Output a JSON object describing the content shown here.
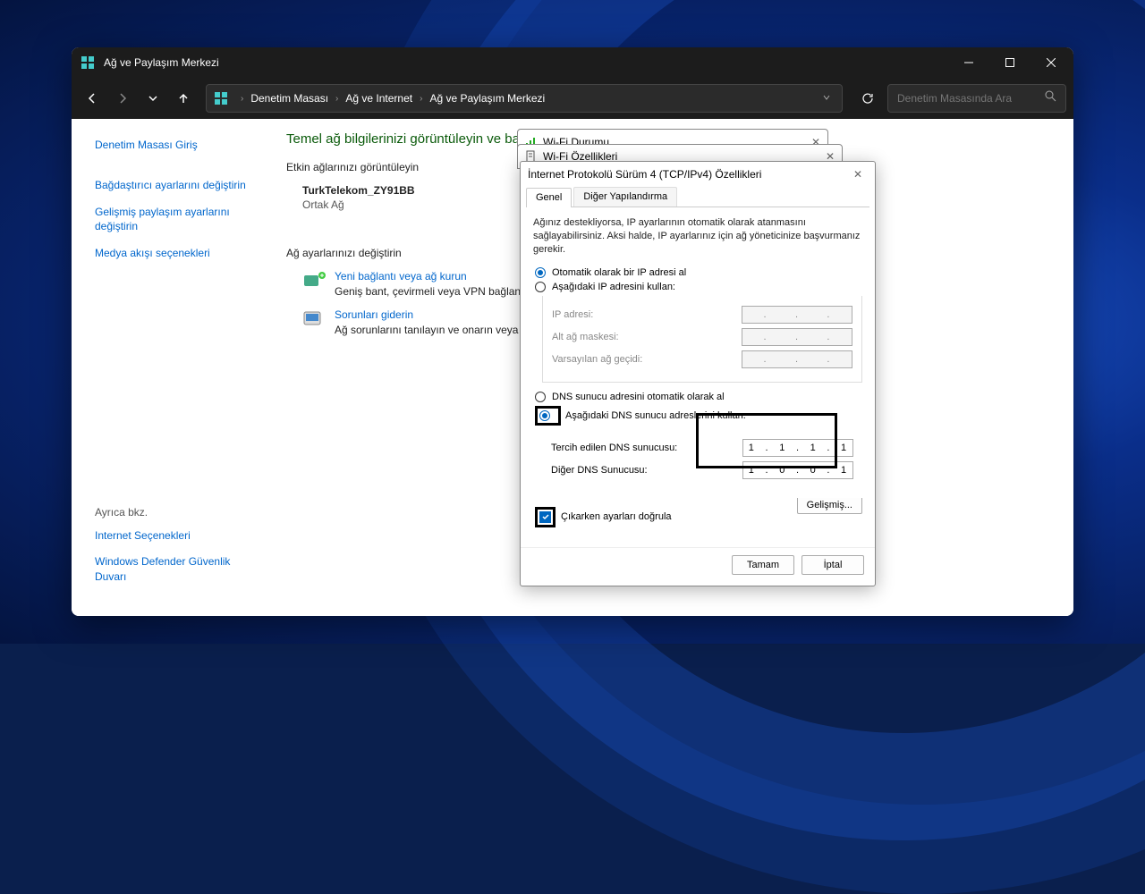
{
  "window": {
    "title": "Ağ ve Paylaşım Merkezi"
  },
  "breadcrumb": {
    "items": [
      "Denetim Masası",
      "Ağ ve Internet",
      "Ağ ve Paylaşım Merkezi"
    ]
  },
  "search": {
    "placeholder": "Denetim Masasında Ara"
  },
  "sidebar": {
    "home": "Denetim Masası Giriş",
    "adapter": "Bağdaştırıcı ayarlarını değiştirin",
    "sharing": "Gelişmiş paylaşım ayarlarını değiştirin",
    "media": "Medya akışı seçenekleri",
    "see_also": "Ayrıca bkz.",
    "internet_opts": "Internet Seçenekleri",
    "defender": "Windows Defender Güvenlik Duvarı"
  },
  "main": {
    "heading": "Temel ağ bilgilerinizi görüntüleyin ve ba",
    "active_label": "Etkin ağlarınızı görüntüleyin",
    "net_name": "TurkTelekom_ZY91BB",
    "net_type": "Ortak Ağ",
    "change_label": "Ağ ayarlarınızı değiştirin",
    "new_conn": "Yeni bağlantı veya ağ kurun",
    "new_conn_desc": "Geniş bant, çevirmeli veya VPN bağlantıs",
    "troubleshoot": "Sorunları giderin",
    "troubleshoot_desc": "Ağ sorunlarını tanılayın ve onarın veya so"
  },
  "wifi_status": {
    "title": "Wi-Fi Durumu"
  },
  "wifi_props": {
    "title": "Wi-Fi Özellikleri"
  },
  "ipv4": {
    "title": "İnternet Protokolü Sürüm 4 (TCP/IPv4) Özellikleri",
    "tabs": {
      "general": "Genel",
      "alt": "Diğer Yapılandırma"
    },
    "help": "Ağınız destekliyorsa, IP ayarlarının otomatik olarak atanmasını sağlayabilirsiniz. Aksi halde, IP ayarlarınız için ağ yöneticinize başvurmanız gerekir.",
    "ip_auto": "Otomatik olarak bir IP adresi al",
    "ip_manual": "Aşağıdaki IP adresini kullan:",
    "ip_addr": "IP adresi:",
    "subnet": "Alt ağ maskesi:",
    "gateway": "Varsayılan ağ geçidi:",
    "dns_auto": "DNS sunucu adresini otomatik olarak al",
    "dns_manual": "Aşağıdaki DNS sunucu adreslerini kullan:",
    "dns_pref": "Tercih edilen DNS sunucusu:",
    "dns_alt": "Diğer DNS Sunucusu:",
    "dns_pref_val": [
      "1",
      "1",
      "1",
      "1"
    ],
    "dns_alt_val": [
      "1",
      "0",
      "0",
      "1"
    ],
    "validate": "Çıkarken ayarları doğrula",
    "advanced": "Gelişmiş...",
    "ok": "Tamam",
    "cancel": "İptal"
  }
}
